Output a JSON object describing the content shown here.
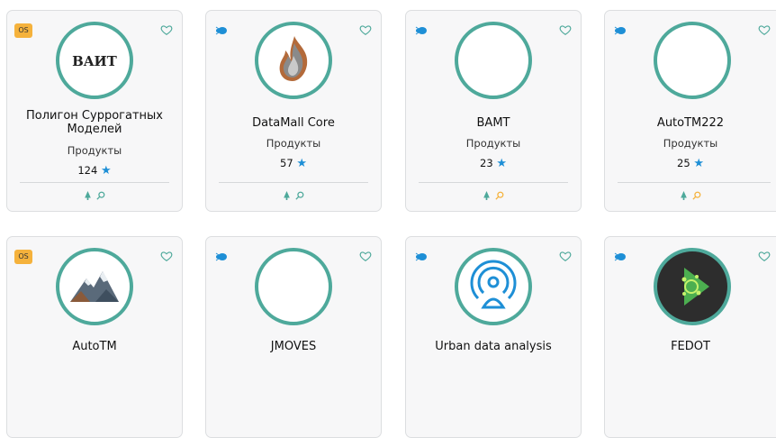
{
  "cards": [
    {
      "badge": "OS",
      "title": "Полигон Суррогатных Моделей",
      "category": "Продукты",
      "stars": "124",
      "logo_text": "BAИT",
      "alert_color": "#4ea99b"
    },
    {
      "badge": "",
      "title": "DataMall Core",
      "category": "Продукты",
      "stars": "57",
      "logo_text": "",
      "alert_color": "#4ea99b"
    },
    {
      "badge": "",
      "title": "BAMT",
      "category": "Продукты",
      "stars": "23",
      "logo_text": "",
      "alert_color": "#f5b23c"
    },
    {
      "badge": "",
      "title": "AutoTM222",
      "category": "Продукты",
      "stars": "25",
      "logo_text": "",
      "alert_color": "#f5b23c"
    },
    {
      "badge": "OS",
      "title": "AutoTM",
      "category": "",
      "stars": "",
      "logo_text": "",
      "alert_color": "#4ea99b"
    },
    {
      "badge": "",
      "title": "JMOVES",
      "category": "",
      "stars": "",
      "logo_text": "",
      "alert_color": "#4ea99b"
    },
    {
      "badge": "",
      "title": "Urban data analysis",
      "category": "",
      "stars": "",
      "logo_text": "",
      "alert_color": "#4ea99b"
    },
    {
      "badge": "",
      "title": "FEDOT",
      "category": "",
      "stars": "",
      "logo_text": "",
      "alert_color": "#4ea99b"
    }
  ],
  "colors": {
    "accent": "#4ea99b",
    "star": "#1e8fd6",
    "badge": "#f5b23c",
    "bug": "#1e8fd6"
  }
}
